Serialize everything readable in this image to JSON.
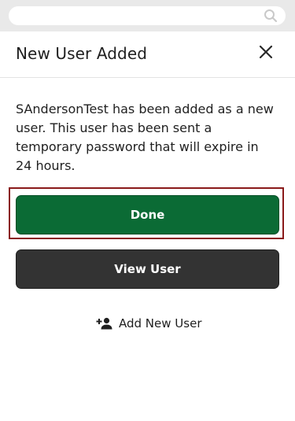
{
  "search": {
    "placeholder": ""
  },
  "modal": {
    "title": "New User Added",
    "message": "SAndersonTest has been added as a new user. This user has been sent a temporary password that will expire in 24 hours.",
    "done_label": "Done",
    "view_user_label": "View User",
    "add_new_user_label": "Add New User"
  },
  "icons": {
    "search": "search-icon",
    "close": "close-icon",
    "add_user": "add-user-icon"
  },
  "colors": {
    "done_button": "#0b6b35",
    "view_user_button": "#333333",
    "focus_outline": "#8a1a1a",
    "top_bar": "#e9e9e9"
  }
}
